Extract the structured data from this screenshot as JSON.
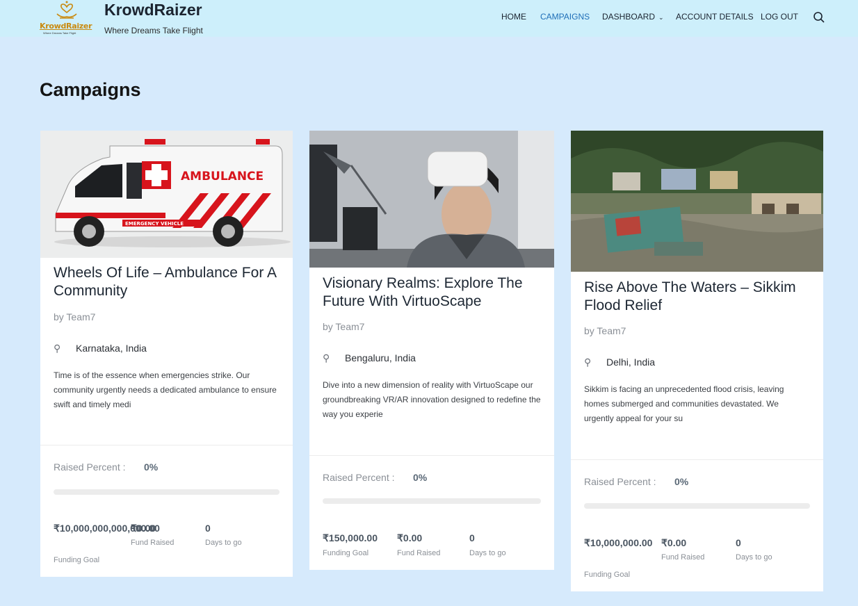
{
  "header": {
    "logo_text": "KrowdRaizer",
    "logo_tagline": "Where Dreams Take Flight",
    "brand": "KrowdRaizer",
    "tagline": "Where Dreams Take Flight",
    "nav": [
      {
        "label": "HOME",
        "active": false
      },
      {
        "label": "CAMPAIGNS",
        "active": true
      },
      {
        "label": "DASHBOARD",
        "active": false,
        "dropdown": true
      },
      {
        "label": "ACCOUNT DETAILS",
        "active": false
      },
      {
        "label": "LOG OUT",
        "active": false
      }
    ],
    "search_icon": "search-icon",
    "colors": {
      "header_bg": "#cdeffb",
      "active_link": "#1f6fb8",
      "page_bg": "#d6eafc"
    }
  },
  "page": {
    "title": "Campaigns"
  },
  "campaigns": [
    {
      "title": "Wheels Of Life – Ambulance For A Community",
      "by": "by Team7",
      "location": "Karnataka, India",
      "description": "Time is of the essence when emergencies strike. Our community urgently needs a dedicated ambulance to ensure swift and timely medi",
      "raised_label": "Raised Percent :",
      "raised_percent": "0%",
      "progress_fraction": 0,
      "funding_goal": "₹10,000,000,000,000.00",
      "funding_goal_label": "Funding Goal",
      "fund_raised": "₹0.00",
      "fund_raised_label": "Fund Raised",
      "days_to_go": "0",
      "days_to_go_label": "Days to go",
      "image": {
        "subject": "ambulance-photo",
        "banner_text": "AMBULANCE",
        "small_text": "EMERGENCY VEHICLE"
      }
    },
    {
      "title": "Visionary Realms: Explore The Future With VirtuoScape",
      "by": "by Team7",
      "location": "Bengaluru, India",
      "description": "Dive into a new dimension of reality with VirtuoScape our groundbreaking VR/AR innovation designed to redefine the way you experie",
      "raised_label": "Raised Percent :",
      "raised_percent": "0%",
      "progress_fraction": 0,
      "funding_goal": "₹150,000.00",
      "funding_goal_label": "Funding Goal",
      "fund_raised": "₹0.00",
      "fund_raised_label": "Fund Raised",
      "days_to_go": "0",
      "days_to_go_label": "Days to go",
      "image": {
        "subject": "vr-headset-photo"
      }
    },
    {
      "title": "Rise Above The Waters – Sikkim Flood Relief",
      "by": "by Team7",
      "location": "Delhi, India",
      "description": "Sikkim is facing an unprecedented flood crisis, leaving homes submerged and communities devastated. We urgently appeal for your su",
      "raised_label": "Raised Percent :",
      "raised_percent": "0%",
      "progress_fraction": 0,
      "funding_goal": "₹10,000,000.00",
      "funding_goal_label": "Funding Goal",
      "fund_raised": "₹0.00",
      "fund_raised_label": "Fund Raised",
      "days_to_go": "0",
      "days_to_go_label": "Days to go",
      "image": {
        "subject": "flood-photo"
      }
    }
  ]
}
